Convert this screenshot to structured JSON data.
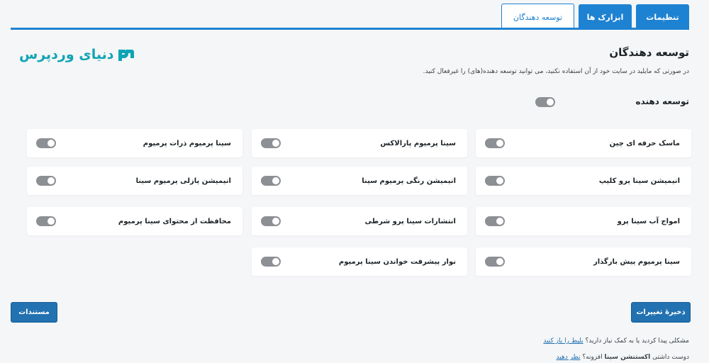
{
  "tabs": [
    {
      "label": "تنظیمات",
      "active": false
    },
    {
      "label": "ابزارک ها",
      "active": false
    },
    {
      "label": "توسعه دهندگان",
      "active": true
    }
  ],
  "brand": {
    "name": "دنیای وردپرس",
    "color": "#10a4b4"
  },
  "page": {
    "title": "توسعه دهندگان",
    "description": "در صورتی که مایلید در سایت خود از آن استفاده نکنید، می توانید توسعه دهنده(های) را غیرفعال کنید."
  },
  "master": {
    "label": "توسعه دهنده"
  },
  "extensions": [
    {
      "label": "ماسک حرفه ای چین"
    },
    {
      "label": "سینا پرمیوم پارالاکس"
    },
    {
      "label": "سینا پرمیوم ذرات پرمیوم"
    },
    {
      "label": "انیمیشن سینا پرو کلیپ"
    },
    {
      "label": "انیمیشن رنگی پرمیوم سینا"
    },
    {
      "label": "انیمیشن پازلی پرمیوم سینا"
    },
    {
      "label": "امواج آب سینا پرو"
    },
    {
      "label": "انتشارات سینا پرو شرطی"
    },
    {
      "label": "محافظت از محتوای سینا پرمیوم"
    },
    {
      "label": "سینا پرمیوم پیش بارگذار"
    },
    {
      "label": "نوار پیشرفت خواندن سینا پرمیوم"
    }
  ],
  "buttons": {
    "save": "ذخیرهٔ تغییرات",
    "docs": "مستندات"
  },
  "help": {
    "line1_text": "مشکلی پیدا کردید یا به کمک نیاز دارید؟",
    "line1_link": "بلیط را باز کنید",
    "line2_prefix": "دوست داشتی",
    "line2_bold": "اکستنشن سینا",
    "line2_suffix": "افزونه؟",
    "line2_link": "نظر دهید"
  },
  "colors": {
    "accent": "#1e82d2",
    "button": "#2271b1",
    "toggle_off": "#8c8f94"
  }
}
